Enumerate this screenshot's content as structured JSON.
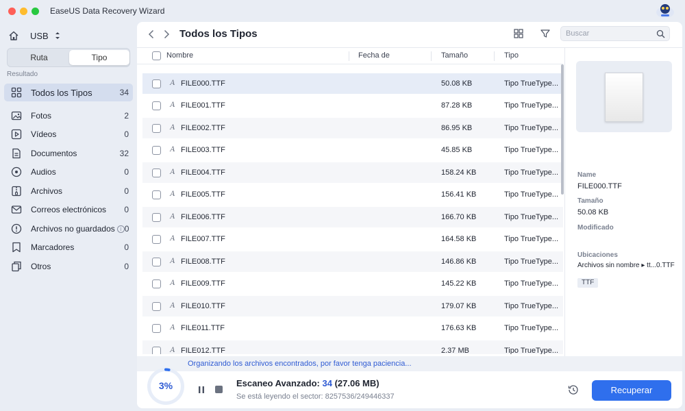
{
  "app": {
    "title": "EaseUS Data Recovery Wizard"
  },
  "sidebar": {
    "drive_label": "USB",
    "tabs": [
      {
        "label": "Ruta"
      },
      {
        "label": "Tipo"
      }
    ],
    "section_label": "Resultado",
    "categories": [
      {
        "label": "Todos los Tipos",
        "count": "34",
        "icon": "grid-icon"
      },
      {
        "label": "Fotos",
        "count": "2",
        "icon": "photo-icon"
      },
      {
        "label": "Vídeos",
        "count": "0",
        "icon": "video-icon"
      },
      {
        "label": "Documentos",
        "count": "32",
        "icon": "document-icon"
      },
      {
        "label": "Audios",
        "count": "0",
        "icon": "audio-icon"
      },
      {
        "label": "Archivos",
        "count": "0",
        "icon": "archive-icon"
      },
      {
        "label": "Correos electrónicos",
        "count": "0",
        "icon": "email-icon"
      },
      {
        "label": "Archivos no guardados",
        "count": "0",
        "icon": "unsaved-icon",
        "info": "i"
      },
      {
        "label": "Marcadores",
        "count": "0",
        "icon": "bookmark-icon"
      },
      {
        "label": "Otros",
        "count": "0",
        "icon": "other-icon"
      }
    ]
  },
  "toolbar": {
    "title": "Todos los Tipos",
    "search_placeholder": "Buscar"
  },
  "table": {
    "headers": {
      "name": "Nombre",
      "date": "Fecha de",
      "size": "Tamaño",
      "type": "Tipo"
    },
    "file_icon_glyph": "A",
    "rows": [
      {
        "name": "FILE000.TTF",
        "size": "50.08 KB",
        "type": "Tipo TrueType..."
      },
      {
        "name": "FILE001.TTF",
        "size": "87.28 KB",
        "type": "Tipo TrueType..."
      },
      {
        "name": "FILE002.TTF",
        "size": "86.95 KB",
        "type": "Tipo TrueType..."
      },
      {
        "name": "FILE003.TTF",
        "size": "45.85 KB",
        "type": "Tipo TrueType..."
      },
      {
        "name": "FILE004.TTF",
        "size": "158.24 KB",
        "type": "Tipo TrueType..."
      },
      {
        "name": "FILE005.TTF",
        "size": "156.41 KB",
        "type": "Tipo TrueType..."
      },
      {
        "name": "FILE006.TTF",
        "size": "166.70 KB",
        "type": "Tipo TrueType..."
      },
      {
        "name": "FILE007.TTF",
        "size": "164.58 KB",
        "type": "Tipo TrueType..."
      },
      {
        "name": "FILE008.TTF",
        "size": "146.86 KB",
        "type": "Tipo TrueType..."
      },
      {
        "name": "FILE009.TTF",
        "size": "145.22 KB",
        "type": "Tipo TrueType..."
      },
      {
        "name": "FILE010.TTF",
        "size": "179.07 KB",
        "type": "Tipo TrueType..."
      },
      {
        "name": "FILE011.TTF",
        "size": "176.63 KB",
        "type": "Tipo TrueType..."
      },
      {
        "name": "FILE012.TTF",
        "size": "2.37 MB",
        "type": "Tipo TrueType..."
      }
    ]
  },
  "details": {
    "name_label": "Name",
    "name_value": "FILE000.TTF",
    "size_label": "Tamaño",
    "size_value": "50.08 KB",
    "modified_label": "Modificado",
    "locations_label": "Ubicaciones",
    "location_value": "Archivos sin nombre ▸ tt...0.TTF",
    "tag": "TTF"
  },
  "footer": {
    "status_message": "Organizando los archivos encontrados, por favor tenga paciencia...",
    "progress_text": "3%",
    "progress_fraction": 0.03,
    "scan_label": "Escaneo Avanzado:",
    "scan_count": "34",
    "scan_size": "(27.06 MB)",
    "sector_text": "Se está leyendo el sector: 8257536/249446337",
    "recover_label": "Recuperar"
  },
  "colors": {
    "accent": "#2f6fed",
    "selected_row": "#e6ecf7",
    "sidebar_active": "#d4ddee"
  }
}
